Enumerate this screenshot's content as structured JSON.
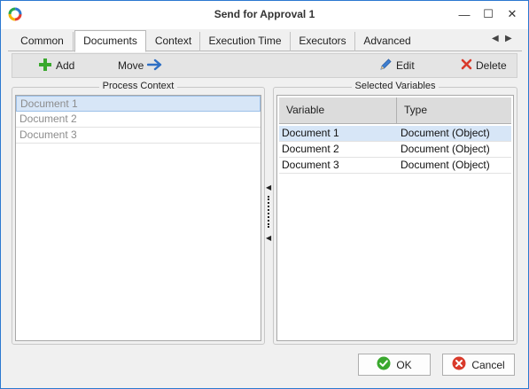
{
  "window": {
    "title": "Send for Approval 1"
  },
  "titlebar": {
    "minimize": "—",
    "maximize": "☐",
    "close": "✕"
  },
  "tabs": [
    {
      "label": "Common"
    },
    {
      "label": "Documents"
    },
    {
      "label": "Context"
    },
    {
      "label": "Execution Time"
    },
    {
      "label": "Executors"
    },
    {
      "label": "Advanced"
    }
  ],
  "tab_scroll": {
    "left": "◀",
    "right": "▶"
  },
  "toolbar": {
    "add_label": "Add",
    "move_label": "Move",
    "edit_label": "Edit",
    "delete_label": "Delete"
  },
  "process_context": {
    "title": "Process Context",
    "items": [
      "Document 1",
      "Document 2",
      "Document 3"
    ],
    "selected_index": 0
  },
  "selected_variables": {
    "title": "Selected Variables",
    "columns": {
      "variable": "Variable",
      "type": "Type"
    },
    "rows": [
      {
        "variable": "Document 1",
        "type": "Document (Object)"
      },
      {
        "variable": "Document 2",
        "type": "Document (Object)"
      },
      {
        "variable": "Document 3",
        "type": "Document (Object)"
      }
    ],
    "selected_index": 0
  },
  "splitter": {
    "arrow": "◀"
  },
  "footer": {
    "ok_label": "OK",
    "cancel_label": "Cancel"
  },
  "colors": {
    "window_border": "#2b78d0",
    "selection": "#d7e6f7",
    "add_green": "#3aa82e",
    "move_blue": "#2e6fc4",
    "delete_red": "#d93a2b"
  }
}
